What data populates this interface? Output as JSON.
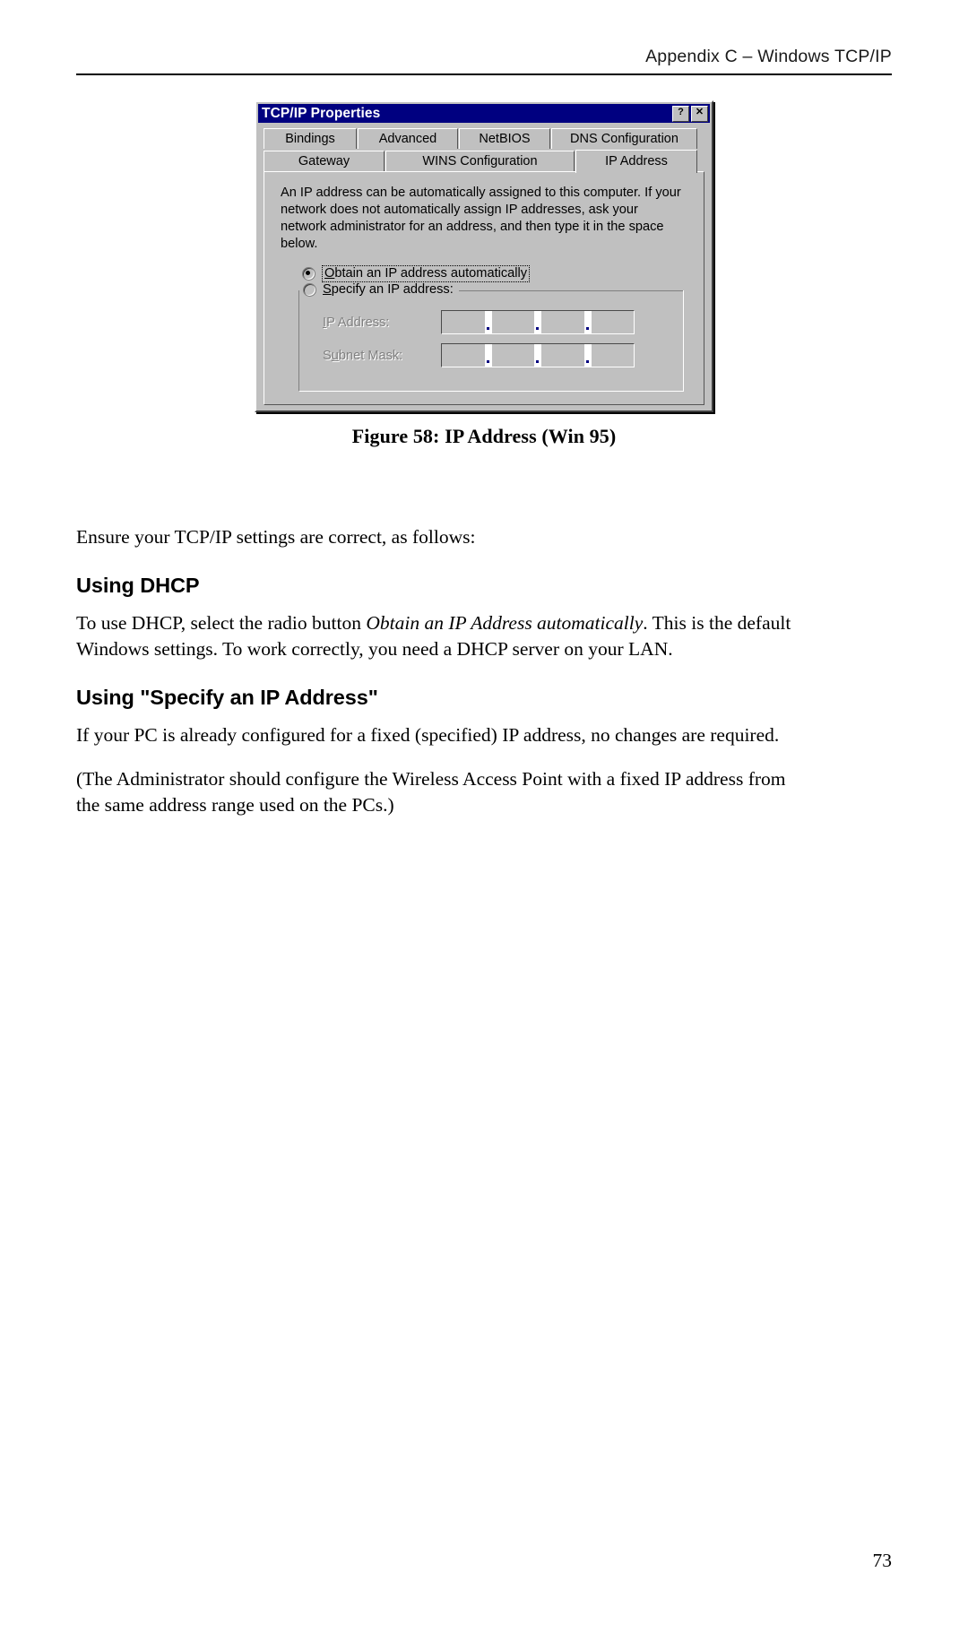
{
  "header": {
    "text": "Appendix C – Windows TCP/IP"
  },
  "figure": {
    "caption": "Figure 58:  IP Address (Win 95)",
    "dialog": {
      "title": "TCP/IP Properties",
      "titlebar_buttons": [
        {
          "name": "help-button",
          "glyph": "?"
        },
        {
          "name": "close-button",
          "glyph": "✕"
        }
      ],
      "tabs_row1": [
        {
          "label": "Bindings",
          "selected": false
        },
        {
          "label": "Advanced",
          "selected": false
        },
        {
          "label": "NetBIOS",
          "selected": false
        },
        {
          "label": "DNS Configuration",
          "selected": false
        }
      ],
      "tabs_row2": [
        {
          "label": "Gateway",
          "selected": false
        },
        {
          "label": "WINS Configuration",
          "selected": false
        },
        {
          "label": "IP Address",
          "selected": true
        }
      ],
      "description": "An IP address can be automatically assigned to this computer.  If your network does not automatically assign IP addresses, ask your network administrator for an address, and then type it in the space below.",
      "radio_auto": {
        "label_accel": "O",
        "label_rest": "btain an IP address automatically",
        "checked": true,
        "focused": true
      },
      "radio_specify": {
        "label_accel": "S",
        "label_rest": "pecify an IP address:",
        "checked": false
      },
      "fields": [
        {
          "label_pre": "",
          "label_accel": "I",
          "label_post": "P Address:",
          "value": "",
          "disabled": true
        },
        {
          "label_pre": "S",
          "label_accel": "u",
          "label_post": "bnet Mask:",
          "value": "",
          "disabled": true
        }
      ],
      "colors": {
        "titlebar": "#000080",
        "face": "#c0c0c0",
        "disabled_text": "#808080"
      }
    }
  },
  "body": {
    "intro": "Ensure your TCP/IP settings are correct, as follows:",
    "section1": {
      "heading": "Using DHCP",
      "para_a": "To use DHCP, select the radio button ",
      "para_a_italic": "Obtain an IP Address automatically",
      "para_a_tail": ". This is the default Windows settings. To work correctly, you need a DHCP server on your LAN."
    },
    "section2": {
      "heading": "Using \"Specify an IP Address\"",
      "para_a": "If your PC is already configured for a fixed (specified) IP address, no changes are required.",
      "para_b": "(The Administrator should configure the Wireless Access Point with a fixed IP address from the same address range used on the PCs.)"
    }
  },
  "footer": {
    "page_number": "73"
  }
}
